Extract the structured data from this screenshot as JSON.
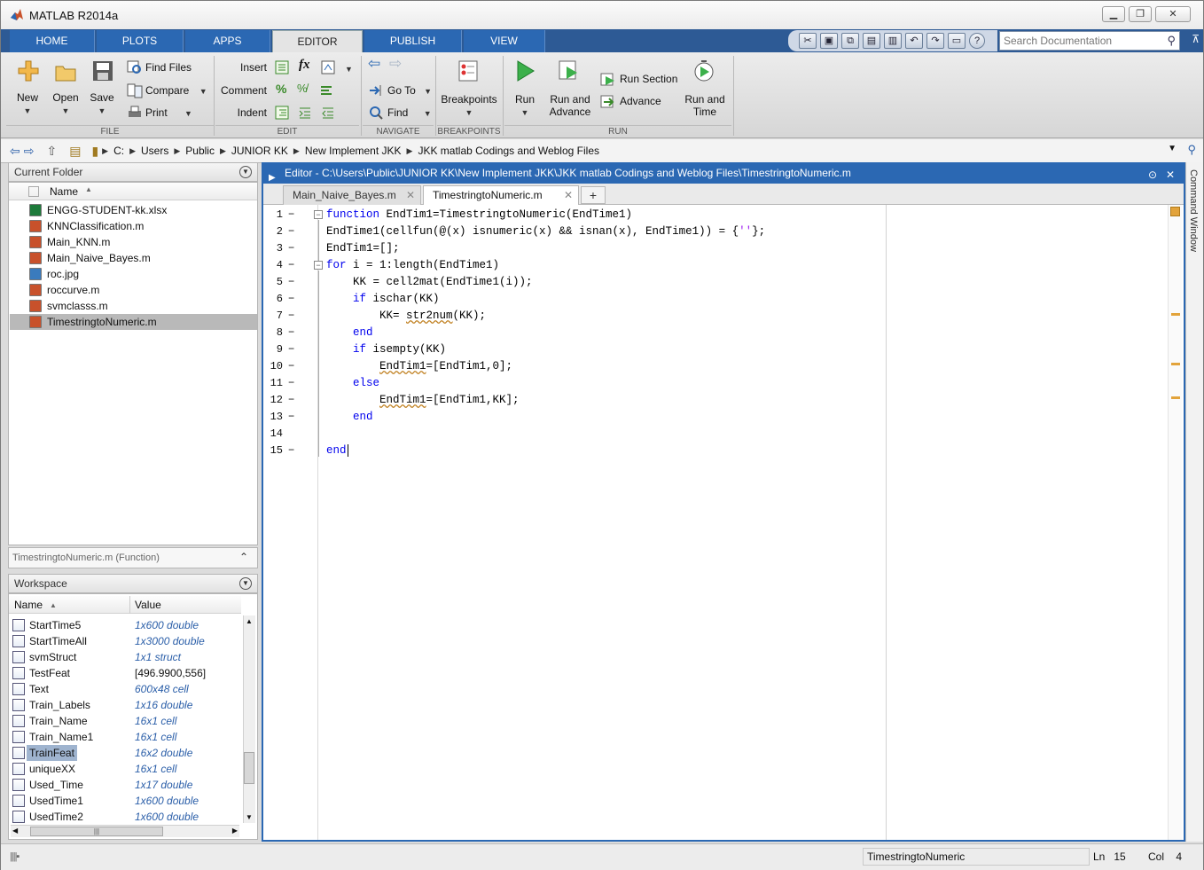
{
  "window": {
    "title": "MATLAB R2014a"
  },
  "tabs": [
    "HOME",
    "PLOTS",
    "APPS",
    "EDITOR",
    "PUBLISH",
    "VIEW"
  ],
  "active_tab": "EDITOR",
  "search": {
    "placeholder": "Search Documentation"
  },
  "ribbon": {
    "file": {
      "label": "FILE",
      "new": "New",
      "open": "Open",
      "save": "Save",
      "find_files": "Find Files",
      "compare": "Compare",
      "print": "Print"
    },
    "edit": {
      "label": "EDIT",
      "insert": "Insert",
      "comment": "Comment",
      "indent": "Indent"
    },
    "navigate": {
      "label": "NAVIGATE",
      "goto": "Go To",
      "find": "Find"
    },
    "breakpoints": {
      "label": "BREAKPOINTS",
      "breakpoints": "Breakpoints"
    },
    "run": {
      "label": "RUN",
      "run": "Run",
      "run_advance_1": "Run and",
      "run_advance_2": "Advance",
      "run_section": "Run Section",
      "advance": "Advance",
      "run_time_1": "Run and",
      "run_time_2": "Time"
    }
  },
  "path": [
    "C:",
    "Users",
    "Public",
    "JUNIOR KK",
    "New Implement JKK",
    "JKK matlab Codings and Weblog Files"
  ],
  "current_folder": {
    "title": "Current Folder",
    "column": "Name",
    "files": [
      {
        "name": "ENGG-STUDENT-kk.xlsx",
        "color": "#1d7a3a"
      },
      {
        "name": "KNNClassification.m",
        "color": "#c8512b"
      },
      {
        "name": "Main_KNN.m",
        "color": "#c8512b"
      },
      {
        "name": "Main_Naive_Bayes.m",
        "color": "#c8512b"
      },
      {
        "name": "roc.jpg",
        "color": "#3a7bbd"
      },
      {
        "name": "roccurve.m",
        "color": "#c8512b"
      },
      {
        "name": "svmclasss.m",
        "color": "#c8512b"
      },
      {
        "name": "TimestringtoNumeric.m",
        "color": "#c8512b"
      }
    ],
    "selected": 7
  },
  "details": {
    "name": "TimestringtoNumeric.m",
    "kind": "(Function)"
  },
  "workspace": {
    "title": "Workspace",
    "columns": [
      "Name",
      "Value"
    ],
    "rows": [
      {
        "name": "StartTime5",
        "value": "1x600 double"
      },
      {
        "name": "StartTimeAll",
        "value": "1x3000 double"
      },
      {
        "name": "svmStruct",
        "value": "1x1 struct"
      },
      {
        "name": "TestFeat",
        "value": "[496.9900,556]"
      },
      {
        "name": "Text",
        "value": "600x48 cell"
      },
      {
        "name": "Train_Labels",
        "value": "1x16 double"
      },
      {
        "name": "Train_Name",
        "value": "16x1 cell"
      },
      {
        "name": "Train_Name1",
        "value": "16x1 cell"
      },
      {
        "name": "TrainFeat",
        "value": "16x2 double"
      },
      {
        "name": "uniqueXX",
        "value": "16x1 cell"
      },
      {
        "name": "Used_Time",
        "value": "1x17 double"
      },
      {
        "name": "UsedTime1",
        "value": "1x600 double"
      },
      {
        "name": "UsedTime2",
        "value": "1x600 double"
      }
    ],
    "selected": 8
  },
  "editor": {
    "title": "Editor - C:\\Users\\Public\\JUNIOR KK\\New Implement JKK\\JKK matlab Codings and Weblog Files\\TimestringtoNumeric.m",
    "tabs": [
      "Main_Naive_Bayes.m",
      "TimestringtoNumeric.m"
    ],
    "active_tab": 1,
    "add_tab": "+",
    "line_numbers": [
      "1",
      "2",
      "3",
      "4",
      "5",
      "6",
      "7",
      "8",
      "9",
      "10",
      "11",
      "12",
      "13",
      "14",
      "15"
    ]
  },
  "side_panel": {
    "command_window": "Command Window"
  },
  "status": {
    "function": "TimestringtoNumeric",
    "ln_label": "Ln",
    "ln": "15",
    "col_label": "Col",
    "col": "4"
  }
}
